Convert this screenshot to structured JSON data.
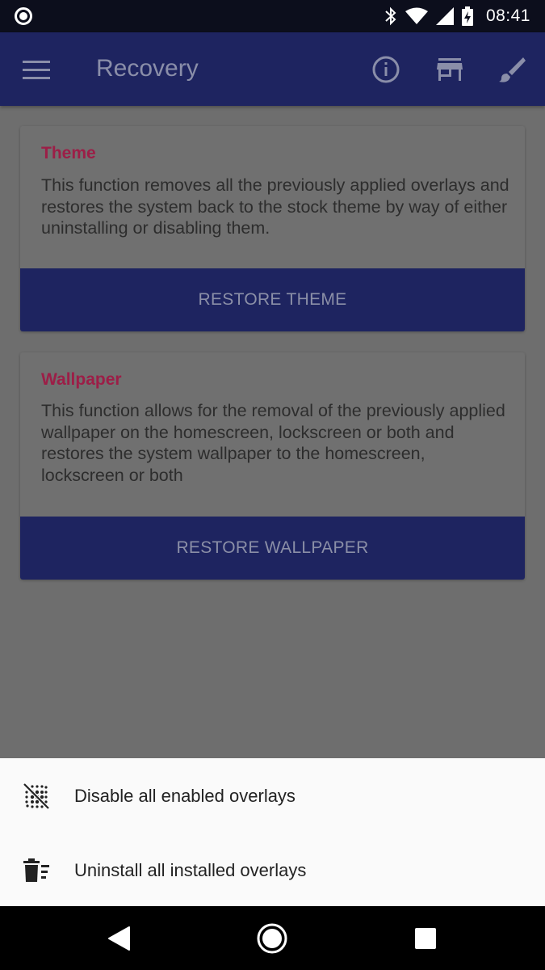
{
  "status_bar": {
    "time": "08:41"
  },
  "app_bar": {
    "title": "Recovery",
    "icons": [
      "menu-icon",
      "info-icon",
      "store-icon",
      "brush-icon"
    ]
  },
  "cards": [
    {
      "title": "Theme",
      "body": "This function removes all the previously applied overlays and restores the system back to the stock theme by way of either uninstalling or disabling them.",
      "button": "RESTORE THEME"
    },
    {
      "title": "Wallpaper",
      "body": "This function allows for the removal of the previously applied wallpaper on the homescreen, lockscreen or both and restores the system wallpaper to the homescreen, lockscreen or both",
      "button": "RESTORE WALLPAPER"
    }
  ],
  "sheet": {
    "items": [
      {
        "label": "Disable all enabled overlays",
        "icon": "disable-overlays-icon"
      },
      {
        "label": "Uninstall all installed overlays",
        "icon": "uninstall-trash-icon"
      }
    ]
  },
  "colors": {
    "primary": "#3f51b5",
    "accent": "#e91e63",
    "scrim": "rgba(0,0,0,0.55)"
  }
}
